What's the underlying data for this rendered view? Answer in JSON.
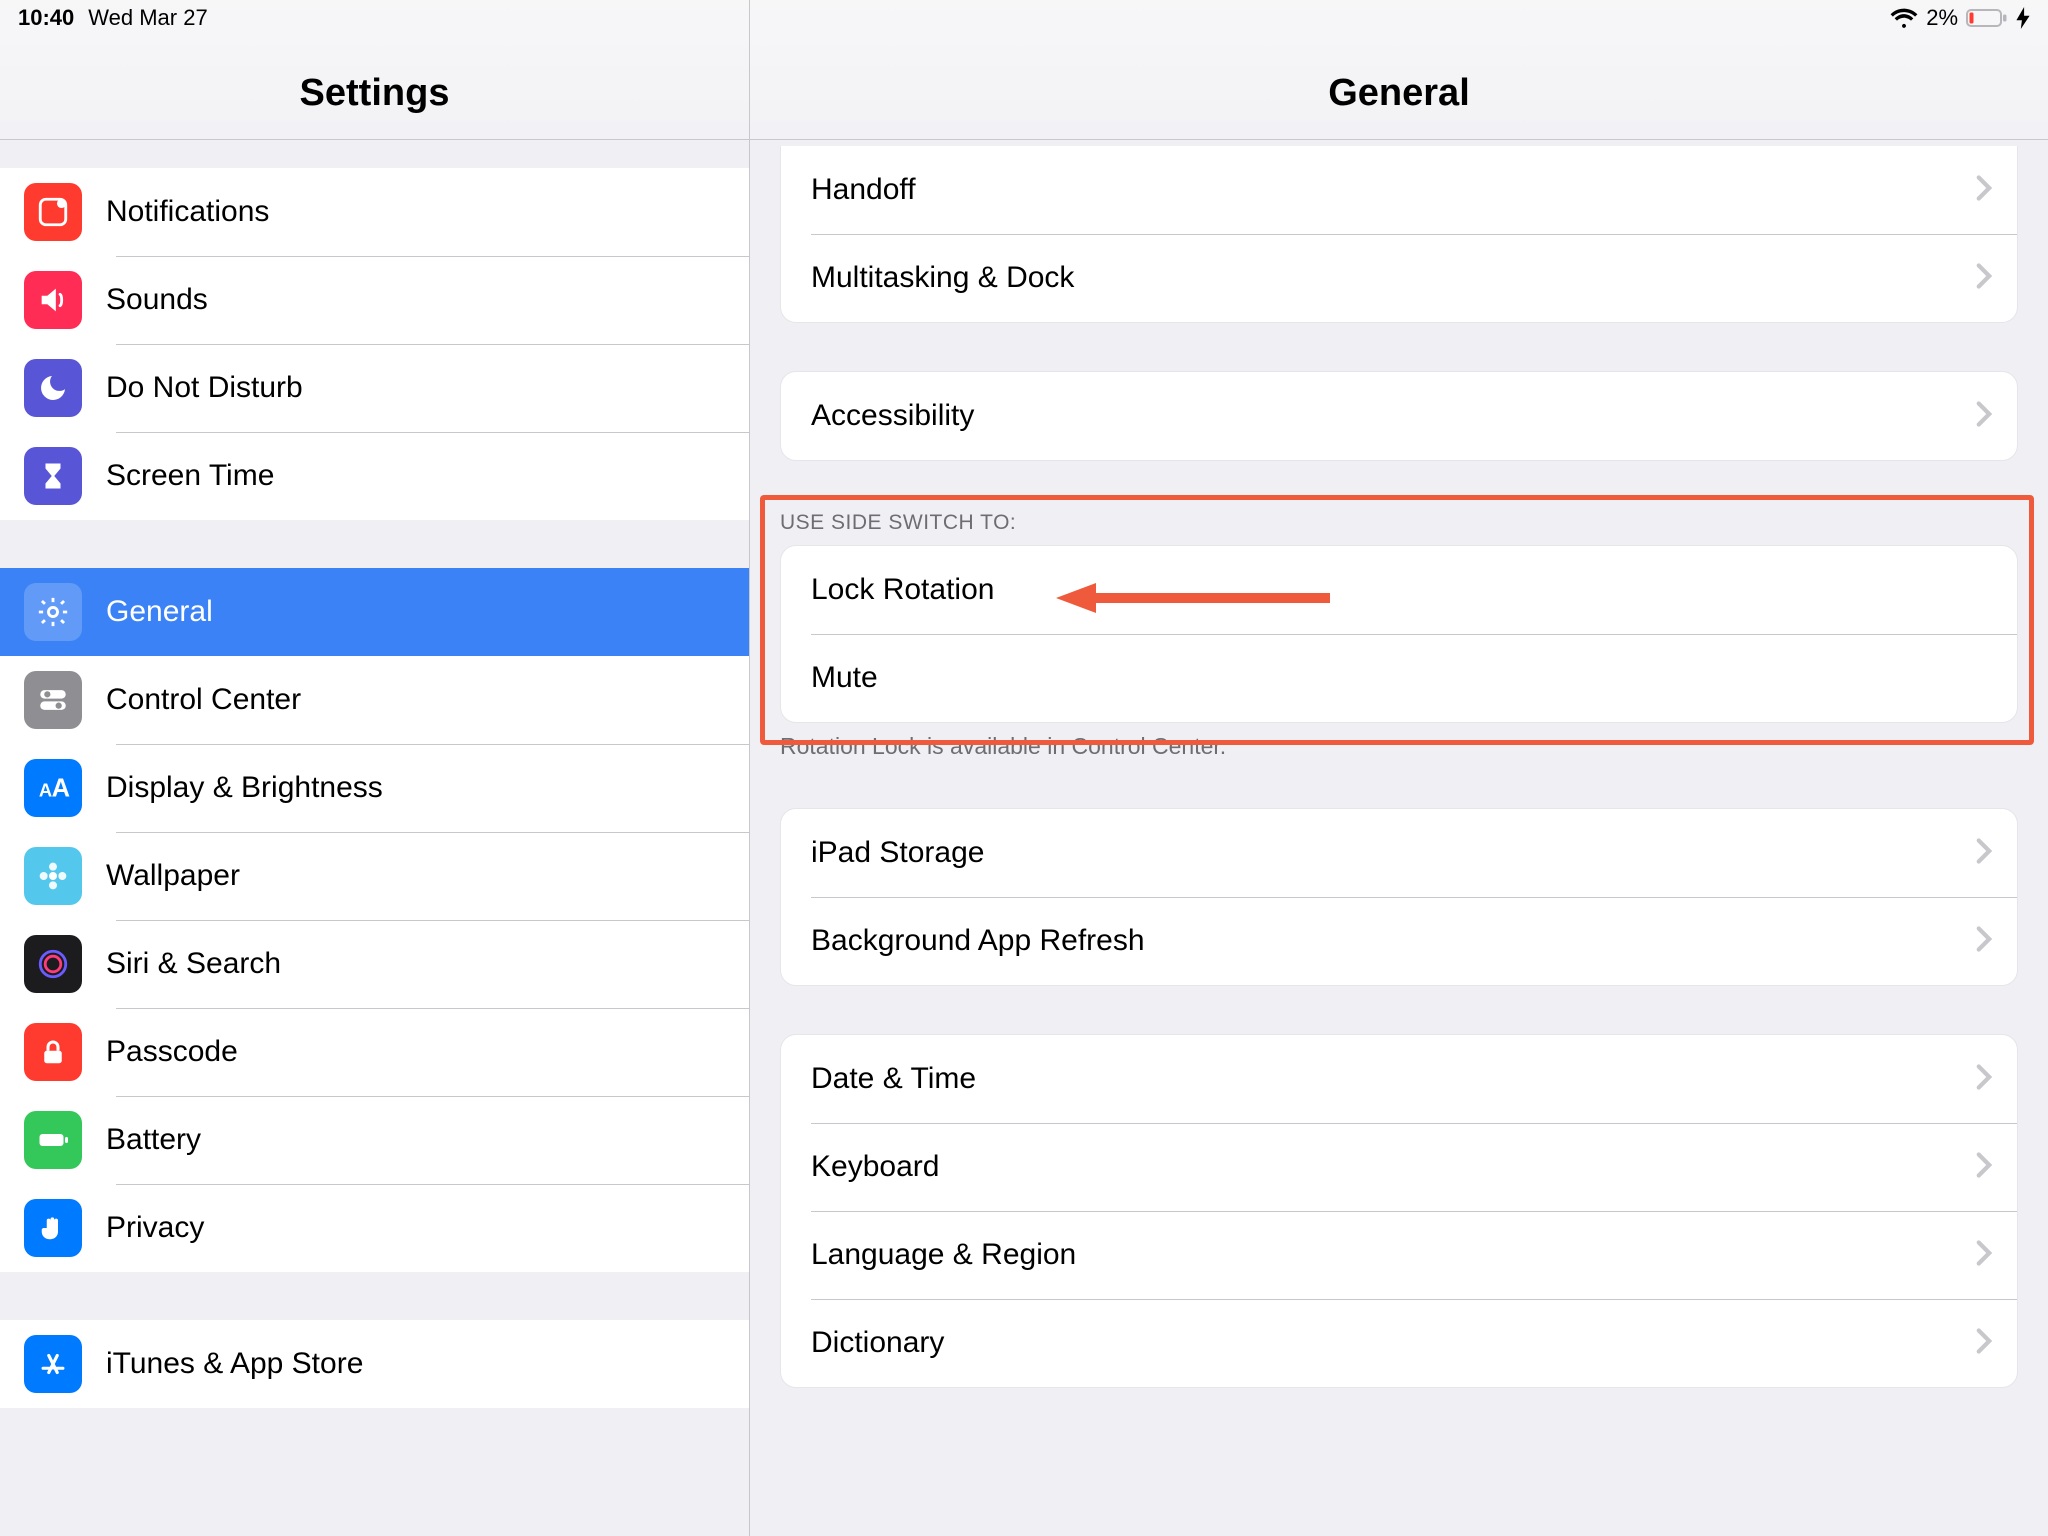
{
  "status": {
    "time": "10:40",
    "date": "Wed Mar 27",
    "battery_pct": "2%"
  },
  "sidebar": {
    "title": "Settings",
    "group1": [
      {
        "label": "Notifications"
      },
      {
        "label": "Sounds"
      },
      {
        "label": "Do Not Disturb"
      },
      {
        "label": "Screen Time"
      }
    ],
    "group2": [
      {
        "label": "General"
      },
      {
        "label": "Control Center"
      },
      {
        "label": "Display & Brightness"
      },
      {
        "label": "Wallpaper"
      },
      {
        "label": "Siri & Search"
      },
      {
        "label": "Passcode"
      },
      {
        "label": "Battery"
      },
      {
        "label": "Privacy"
      }
    ],
    "group3": [
      {
        "label": "iTunes & App Store"
      }
    ]
  },
  "content": {
    "title": "General",
    "group_top": [
      {
        "label": "Handoff"
      },
      {
        "label": "Multitasking & Dock"
      }
    ],
    "group_accessibility": [
      {
        "label": "Accessibility"
      }
    ],
    "side_switch_header": "Use Side Switch To:",
    "side_switch_items": [
      {
        "label": "Lock Rotation"
      },
      {
        "label": "Mute"
      }
    ],
    "side_switch_footer": "Rotation Lock is available in Control Center.",
    "group_storage": [
      {
        "label": "iPad Storage"
      },
      {
        "label": "Background App Refresh"
      }
    ],
    "group_datetime": [
      {
        "label": "Date & Time"
      },
      {
        "label": "Keyboard"
      },
      {
        "label": "Language & Region"
      },
      {
        "label": "Dictionary"
      }
    ]
  },
  "colors": {
    "selected": "#3b82f6",
    "annotation": "#f05a3c"
  }
}
